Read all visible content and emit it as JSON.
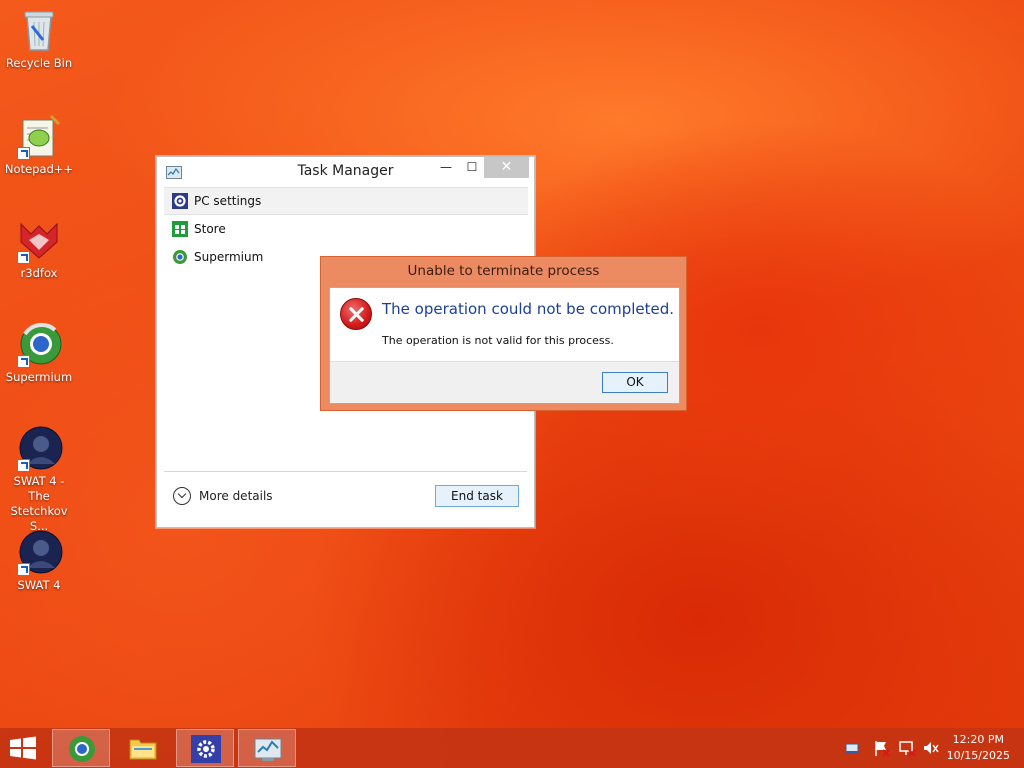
{
  "desktop": {
    "icons": [
      {
        "label": "Recycle Bin"
      },
      {
        "label": "Notepad++"
      },
      {
        "label": "r3dfox"
      },
      {
        "label": "Supermium"
      },
      {
        "label": "SWAT 4 - The Stetchkov S..."
      },
      {
        "label": "SWAT 4"
      }
    ]
  },
  "task_manager": {
    "title": "Task Manager",
    "minimize": "—",
    "maximize": "☐",
    "close": "✕",
    "apps": [
      {
        "name": "PC settings",
        "icon": "gear-icon"
      },
      {
        "name": "Store",
        "icon": "store-icon"
      },
      {
        "name": "Supermium",
        "icon": "supermium-icon"
      }
    ],
    "more_details": "More details",
    "end_task": "End task"
  },
  "error_dialog": {
    "title": "Unable to terminate process",
    "main_instruction": "The operation could not be completed.",
    "content": "The operation is not valid for this process.",
    "ok": "OK"
  },
  "taskbar": {
    "time": "12:20 PM",
    "date": "10/15/2025",
    "pinned": [
      "supermium-icon",
      "file-explorer-icon",
      "pc-settings-icon",
      "task-manager-icon"
    ]
  },
  "colors": {
    "accent": "#c43412",
    "dialog_frame": "#ec8a62",
    "end_task_border": "#6fa9dc"
  }
}
